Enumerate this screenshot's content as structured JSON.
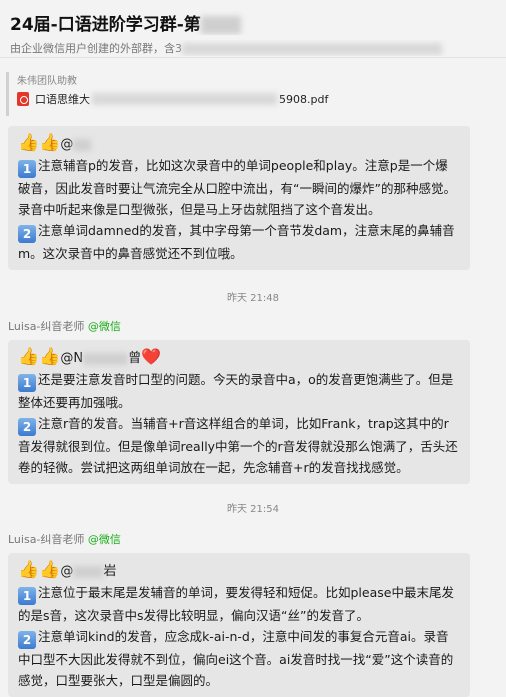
{
  "header": {
    "title": "24届-口语进阶学习群-第",
    "subtitle": "由企业微信用户创建的外部群，含3"
  },
  "file_card": {
    "sender": "朱伟团队助教",
    "file_prefix": "口语思维大",
    "file_suffix": "5908.pdf"
  },
  "messages": [
    {
      "emoji": "👍👍",
      "mention": "@",
      "p1": "注意辅音p的发音，比如这次录音中的单词people和play。注意p是一个爆破音，因此发音时要让气流完全从口腔中流出，有“一瞬间的爆炸”的那种感觉。录音中听起来像是口型微张，但是马上牙齿就阻挡了这个音发出。",
      "p2": "注意单词damned的发音，其中字母第一个音节发dam，注意末尾的鼻辅音m。这次录音中的鼻音感觉还不到位哦。"
    },
    {
      "time": "昨天 21:48",
      "sender": "Luisa-纠音老师",
      "source": "@微信",
      "emoji": "👍👍",
      "mention_a": "@N",
      "mention_b": "曾",
      "heart": "❤️",
      "p1": "还是要注意发音时口型的问题。今天的录音中a，o的发音更饱满些了。但是整体还要再加强哦。",
      "p2": "注意r音的发音。当辅音+r音这样组合的单词，比如Frank，trap这其中的r音发得就很到位。但是像单词really中第一个的r音发得就没那么饱满了，舌头还卷的轻微。尝试把这两组单词放在一起，先念辅音+r的发音找找感觉。"
    },
    {
      "time": "昨天 21:54",
      "sender": "Luisa-纠音老师",
      "source": "@微信",
      "emoji": "👍👍",
      "mention": "@",
      "mention_tail": "岩",
      "p1": "注意位于最末尾是发辅音的单词，要发得轻和短促。比如please中最末尾发的是s音，这次录音中s发得比较明显，偏向汉语“丝”的发音了。",
      "p2": "注意单词kind的发音，应念成k-ai-n-d，注意中间发的事复合元音ai。录音中口型不大因此发得就不到位，偏向ei这个音。ai发音时找一找“爱”这个读音的感觉，口型要张大，口型是偏圆的。"
    }
  ],
  "icons": {
    "num1": "1",
    "num2": "2"
  }
}
